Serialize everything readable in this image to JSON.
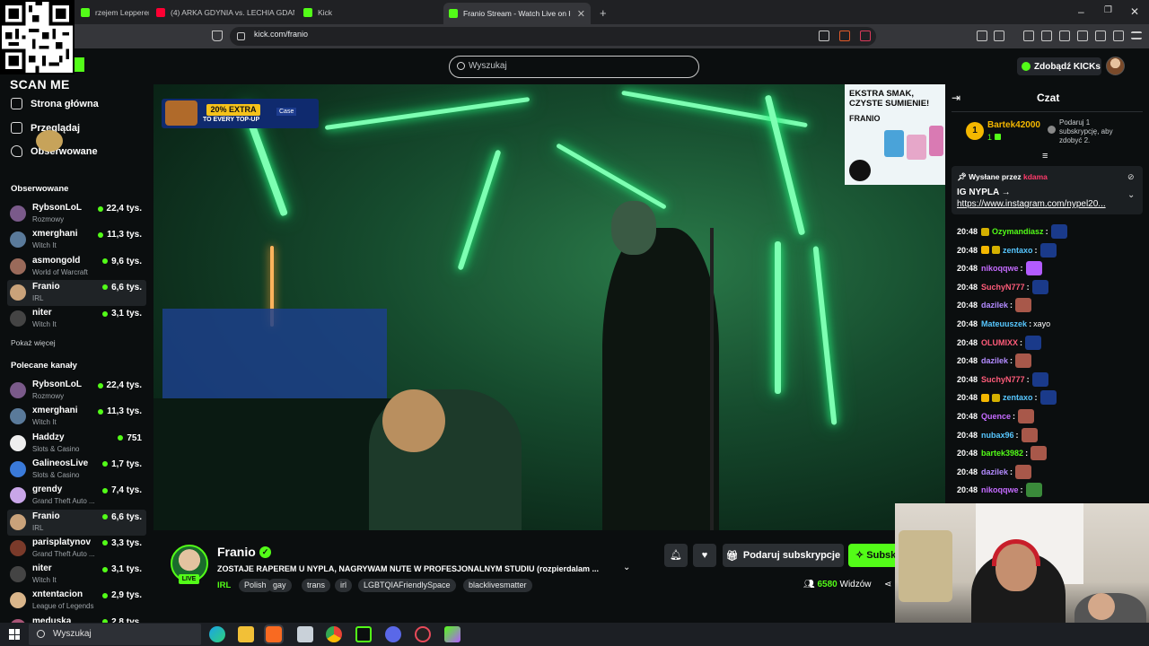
{
  "browser": {
    "tabs": [
      {
        "label": "rzejem Lepperem! (",
        "icon": "kick"
      },
      {
        "label": "(4) ARKA GDYNIA vs. LECHIA GDAŃS",
        "icon": "youtube"
      },
      {
        "label": "Kick",
        "icon": "kick"
      },
      {
        "label": "Franio Stream - Watch Live on K",
        "icon": "kick",
        "active": true
      }
    ],
    "new_tab": "+",
    "url": "kick.com/franio",
    "window_controls": [
      "–",
      "❐",
      "✕"
    ]
  },
  "overlay": {
    "scan_me": "SCAN ME"
  },
  "header": {
    "search_placeholder": "Wyszukaj",
    "kicks_button": "Zdobądź KICKs",
    "accent": "#53fc18"
  },
  "sidebar": {
    "nav": [
      {
        "label": "Strona główna",
        "icon": "home-icon"
      },
      {
        "label": "Przeglądaj",
        "icon": "browse-icon"
      },
      {
        "label": "Obserwowane",
        "icon": "heart-icon"
      }
    ],
    "followed_title": "Obserwowane",
    "followed": [
      {
        "name": "RybsonLoL",
        "category": "Rozmowy",
        "viewers": "22,4 tys.",
        "color": "#7a5a8a"
      },
      {
        "name": "xmerghani",
        "category": "Witch It",
        "viewers": "11,3 tys.",
        "color": "#5a7a9a"
      },
      {
        "name": "asmongold",
        "category": "World of Warcraft",
        "viewers": "9,6 tys.",
        "color": "#9a6a5a"
      },
      {
        "name": "Franio",
        "category": "IRL",
        "viewers": "6,6 tys.",
        "color": "#c9a27a",
        "selected": true
      },
      {
        "name": "niter",
        "category": "Witch It",
        "viewers": "3,1 tys.",
        "color": "#444"
      }
    ],
    "show_more": "Pokaż więcej",
    "recommended_title": "Polecane kanały",
    "recommended": [
      {
        "name": "RybsonLoL",
        "category": "Rozmowy",
        "viewers": "22,4 tys.",
        "color": "#7a5a8a"
      },
      {
        "name": "xmerghani",
        "category": "Witch It",
        "viewers": "11,3 tys.",
        "color": "#5a7a9a"
      },
      {
        "name": "Haddzy",
        "category": "Slots & Casino",
        "viewers": "751",
        "color": "#eeeeee"
      },
      {
        "name": "GalineosLive",
        "category": "Slots & Casino",
        "viewers": "1,7 tys.",
        "color": "#3a7ad9"
      },
      {
        "name": "grendy",
        "category": "Grand Theft Auto ...",
        "viewers": "7,4 tys.",
        "color": "#c9a6e8"
      },
      {
        "name": "Franio",
        "category": "IRL",
        "viewers": "6,6 tys.",
        "color": "#c9a27a",
        "selected": true
      },
      {
        "name": "parisplatynov",
        "category": "Grand Theft Auto ...",
        "viewers": "3,3 tys.",
        "color": "#7a3a2a"
      },
      {
        "name": "niter",
        "category": "Witch It",
        "viewers": "3,1 tys.",
        "color": "#444"
      },
      {
        "name": "xntentacion",
        "category": "League of Legends",
        "viewers": "2,9 tys.",
        "color": "#d9b58a"
      },
      {
        "name": "meduska",
        "category": "",
        "viewers": "2,8 tys.",
        "color": "#aa5577"
      }
    ]
  },
  "video": {
    "promo_badge": "20% EXTRA",
    "promo_sub": "TO EVERY TOP-UP",
    "promo_logo": "Case",
    "ad_title": "EKSTRA SMAK, CZYSTE SUMIENIE!",
    "ad_brand": "FRANIO"
  },
  "stream": {
    "name": "Franio",
    "live": "LIVE",
    "title": "ZOSTAJE RAPEREM U NYPLA, NAGRYWAM NUTE W PROFESJONALNYM STUDIU (rozpierdalam ...",
    "category": "IRL",
    "tags": [
      "Polish",
      "gay",
      "trans",
      "irl",
      "LGBTQIAFriendlySpace",
      "blacklivesmatter"
    ],
    "gift_button": "Podaruj subskrypcje",
    "subscribe_button": "Subskrybuj",
    "viewer_count": "6580",
    "viewer_label": "Widzów"
  },
  "chat": {
    "title": "Czat",
    "leader": {
      "rank": "1",
      "name": "Bartek42000",
      "count": "1",
      "note": "Podaruj 1 subskrypcję, aby zdobyć 2."
    },
    "pinned": {
      "by_prefix": "Wysłane przez",
      "by_user": "kdama",
      "heading": "IG NYPLA →",
      "link": "https://www.instagram.com/nypel20..."
    },
    "messages": [
      {
        "time": "20:48",
        "user": "Ozymandiasz",
        "color": "#53fc18",
        "text": "",
        "emote": "#1a3a8a",
        "badges": [
          "#d4b000"
        ]
      },
      {
        "time": "20:48",
        "user": "zentaxo",
        "color": "#57c7ff",
        "text": "",
        "emote": "#1a3a8a",
        "badges": [
          "#f4b700",
          "#d4b000"
        ]
      },
      {
        "time": "20:48",
        "user": "nikoqqwe",
        "color": "#c56bff",
        "text": "",
        "emote": "#b35cff"
      },
      {
        "time": "20:48",
        "user": "SuchyN777",
        "color": "#ff5c7a",
        "text": "",
        "emote": "#1a3a8a"
      },
      {
        "time": "20:48",
        "user": "dazilek",
        "color": "#b38bff",
        "text": "",
        "emote": "#a8584a"
      },
      {
        "time": "20:48",
        "user": "Mateuuszek",
        "color": "#57c7ff",
        "text": "xayo"
      },
      {
        "time": "20:48",
        "user": "OLUMIXX",
        "color": "#ff5c7a",
        "text": "",
        "emote": "#1a3a8a"
      },
      {
        "time": "20:48",
        "user": "dazilek",
        "color": "#b38bff",
        "text": "",
        "emote": "#a8584a"
      },
      {
        "time": "20:48",
        "user": "SuchyN777",
        "color": "#ff5c7a",
        "text": "",
        "emote": "#1a3a8a"
      },
      {
        "time": "20:48",
        "user": "zentaxo",
        "color": "#57c7ff",
        "text": "",
        "emote": "#1a3a8a",
        "badges": [
          "#f4b700",
          "#d4b000"
        ]
      },
      {
        "time": "20:48",
        "user": "Quence",
        "color": "#c56bff",
        "text": "",
        "emote": "#a8584a"
      },
      {
        "time": "20:48",
        "user": "nubax96",
        "color": "#57c7ff",
        "text": "",
        "emote": "#a8584a"
      },
      {
        "time": "20:48",
        "user": "bartek3982",
        "color": "#53fc18",
        "text": "",
        "emote": "#a8584a"
      },
      {
        "time": "20:48",
        "user": "dazilek",
        "color": "#b38bff",
        "text": "",
        "emote": "#a8584a"
      },
      {
        "time": "20:48",
        "user": "nikoqqwe",
        "color": "#c56bff",
        "text": "",
        "emote": "#3a8a3a"
      }
    ]
  },
  "taskbar": {
    "search": "Wyszukaj"
  }
}
